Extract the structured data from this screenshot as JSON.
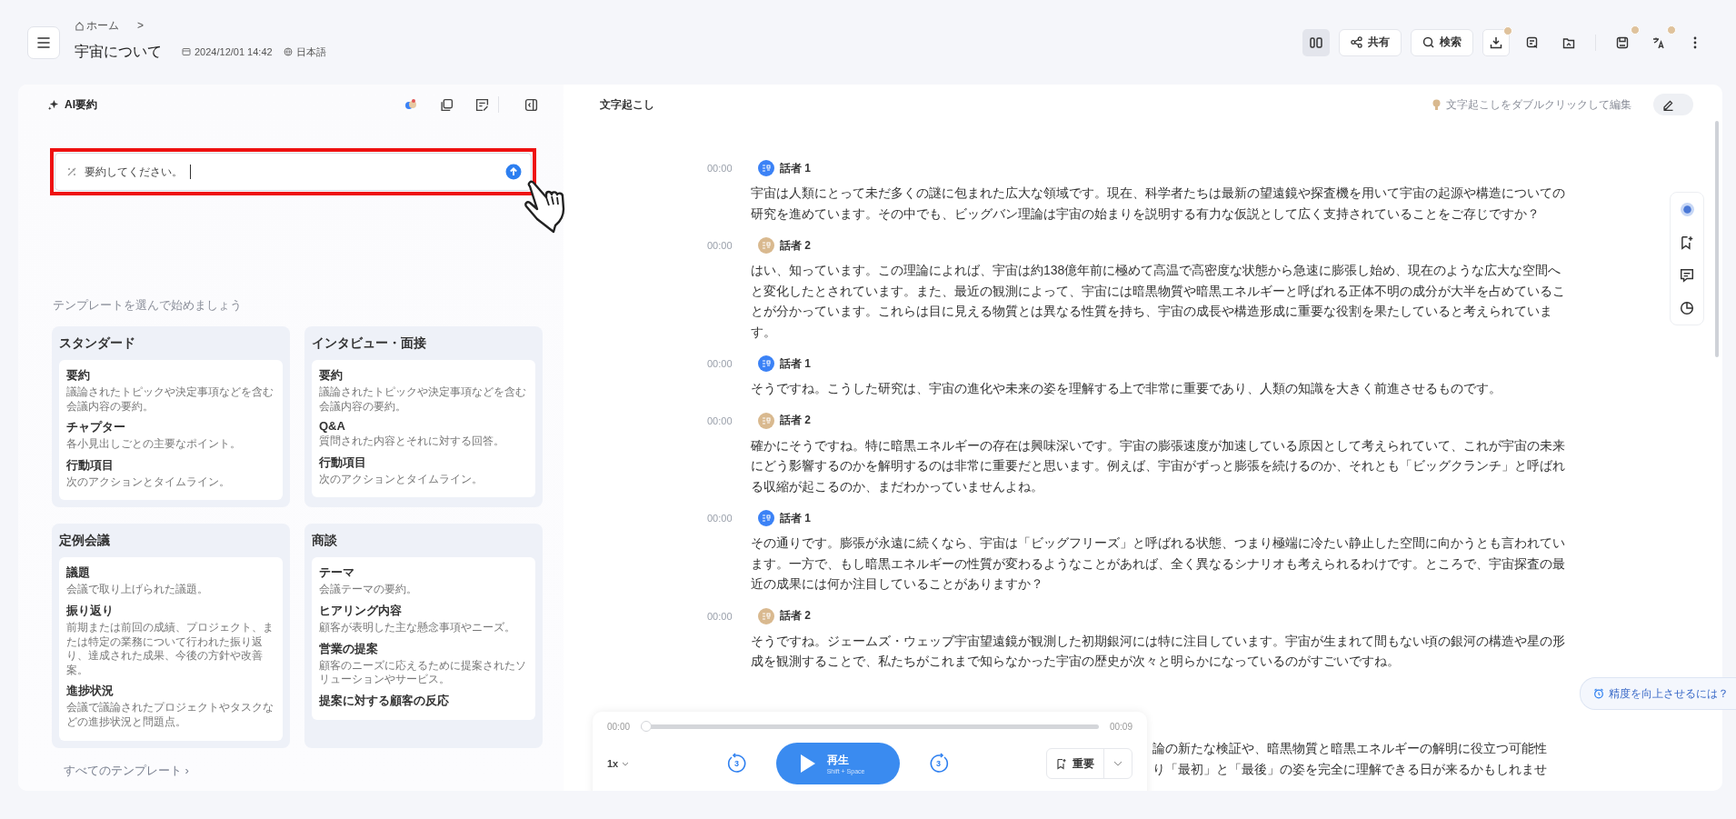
{
  "header": {
    "breadcrumb": "ホーム",
    "breadcrumb_separator": ">",
    "title": "宇宙について",
    "date": "2024/12/01 14:42",
    "language": "日本語"
  },
  "toolbar": {
    "layout_selected": true,
    "share_label": "共有",
    "search_label": "検索",
    "icons": [
      {
        "dot": true
      },
      {
        "dot": false
      },
      {
        "dot": false
      },
      {
        "dot": true
      },
      {
        "dot": true
      }
    ]
  },
  "summary": {
    "title": "AI要約",
    "prompt": {
      "value": "要約してください。"
    },
    "templates_heading": "テンプレートを選んで始めましょう",
    "templates": [
      {
        "name": "スタンダード",
        "items": [
          {
            "title": "要約",
            "description": "議論されたトピックや決定事項などを含む会議内容の要約。"
          },
          {
            "title": "チャプター",
            "description": "各小見出しごとの主要なポイント。"
          },
          {
            "title": "行動項目",
            "description": "次のアクションとタイムライン。"
          }
        ]
      },
      {
        "name": "インタビュー・面接",
        "items": [
          {
            "title": "要約",
            "description": "議論されたトピックや決定事項などを含む会議内容の要約。"
          },
          {
            "title": "Q&A",
            "description": "質問された内容とそれに対する回答。"
          },
          {
            "title": "行動項目",
            "description": "次のアクションとタイムライン。"
          }
        ]
      },
      {
        "name": "定例会議",
        "items": [
          {
            "title": "議題",
            "description": "会議で取り上げられた議題。"
          },
          {
            "title": "振り返り",
            "description": "前期または前回の成績、プロジェクト、または特定の業務について行われた振り返り、達成された成果、今後の方針や改善案。"
          },
          {
            "title": "進捗状況",
            "description": "会議で議論されたプロジェクトやタスクなどの進捗状況と問題点。"
          }
        ]
      },
      {
        "name": "商談",
        "items": [
          {
            "title": "テーマ",
            "description": "会議テーマの要約。"
          },
          {
            "title": "ヒアリング内容",
            "description": "顧客が表明した主な懸念事項やニーズ。"
          },
          {
            "title": "営業の提案",
            "description": "顧客のニーズに応えるために提案されたソリューションやサービス。"
          },
          {
            "title": "提案に対する顧客の反応"
          }
        ]
      }
    ],
    "all_templates": "すべてのテンプレート",
    "all_templates_chevron": "›"
  },
  "transcript": {
    "title": "文字起こし",
    "hint": "文字起こしをダブルクリックして編集",
    "edit_mode": false,
    "entries": [
      {
        "time": "00:00",
        "speaker": "話者 1",
        "color": "#3b82f6",
        "text": "宇宙は人類にとって未だ多くの謎に包まれた広大な領域です。現在、科学者たちは最新の望遠鏡や探査機を用いて宇宙の起源や構造についての研究を進めています。その中でも、ビッグバン理論は宇宙の始まりを説明する有力な仮説として広く支持されていることをご存じですか？"
      },
      {
        "time": "00:00",
        "speaker": "話者 2",
        "color": "#d9b98f",
        "text": "はい、知っています。この理論によれば、宇宙は約138億年前に極めて高温で高密度な状態から急速に膨張し始め、現在のような広大な空間へと変化したとされています。また、最近の観測によって、宇宙には暗黒物質や暗黒エネルギーと呼ばれる正体不明の成分が大半を占めていることが分かっています。これらは目に見える物質とは異なる性質を持ち、宇宙の成長や構造形成に重要な役割を果たしていると考えられています。"
      },
      {
        "time": "00:00",
        "speaker": "話者 1",
        "color": "#3b82f6",
        "text": "そうですね。こうした研究は、宇宙の進化や未来の姿を理解する上で非常に重要であり、人類の知識を大きく前進させるものです。"
      },
      {
        "time": "00:00",
        "speaker": "話者 2",
        "color": "#d9b98f",
        "text": "確かにそうですね。特に暗黒エネルギーの存在は興味深いです。宇宙の膨張速度が加速している原因として考えられていて、これが宇宙の未来にどう影響するのかを解明するのは非常に重要だと思います。例えば、宇宙がずっと膨張を続けるのか、それとも「ビッグクランチ」と呼ばれる収縮が起こるのか、まだわかっていませんよね。"
      },
      {
        "time": "00:00",
        "speaker": "話者 1",
        "color": "#3b82f6",
        "text": "その通りです。膨張が永遠に続くなら、宇宙は「ビッグフリーズ」と呼ばれる状態、つまり極端に冷たい静止した空間に向かうとも言われています。一方で、もし暗黒エネルギーの性質が変わるようなことがあれば、全く異なるシナリオも考えられるわけです。ところで、宇宙探査の最近の成果には何か注目していることがありますか？"
      },
      {
        "time": "00:00",
        "speaker": "話者 2",
        "color": "#d9b98f",
        "text": "そうですね。ジェームズ・ウェッブ宇宙望遠鏡が観測した初期銀河には特に注目しています。宇宙が生まれて間もない頃の銀河の構造や星の形成を観測することで、私たちがこれまで知らなかった宇宙の歴史が次々と明らかになっているのがすごいですね。"
      }
    ],
    "partial_lines": [
      "論の新たな検証や、暗黒物質と暗黒エネルギーの解明に役立つ可能性",
      "り「最初」と「最後」の姿を完全に理解できる日が来るかもしれませ"
    ]
  },
  "accuracy_link": "精度を向上させるには？",
  "player": {
    "start": "00:00",
    "end": "00:09",
    "level": 0,
    "speed": "1x",
    "skip_back": "3",
    "skip_forward": "3",
    "play": "再生",
    "shortcut": "Shift + Space",
    "bookmark": "重要"
  }
}
